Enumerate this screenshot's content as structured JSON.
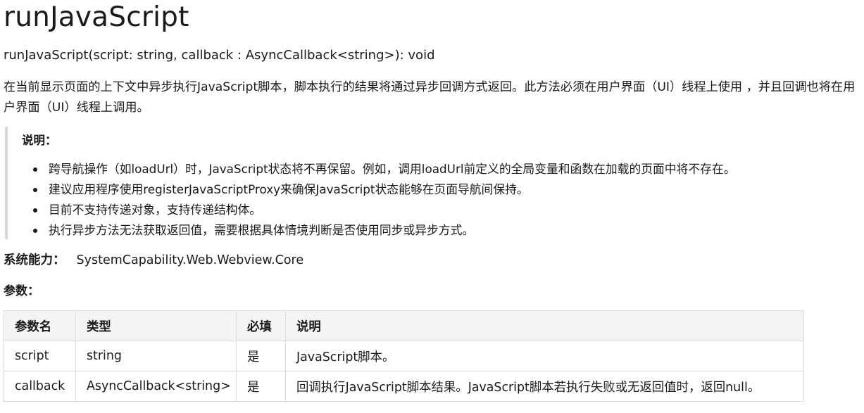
{
  "title": "runJavaScript",
  "signature": "runJavaScript(script: string, callback : AsyncCallback<string>): void",
  "description": "在当前显示页面的上下文中异步执行JavaScript脚本，脚本执行的结果将通过异步回调方式返回。此方法必须在用户界面（UI）线程上使用 ，并且回调也将在用户界面（UI）线程上调用。",
  "note": {
    "title": "说明：",
    "items": [
      "跨导航操作（如loadUrl）时，JavaScript状态将不再保留。例如，调用loadUrl前定义的全局变量和函数在加载的页面中将不存在。",
      "建议应用程序使用registerJavaScriptProxy来确保JavaScript状态能够在页面导航间保持。",
      "目前不支持传递对象，支持传递结构体。",
      "执行异步方法无法获取返回值，需要根据具体情境判断是否使用同步或异步方式。"
    ]
  },
  "syscap": {
    "label": "系统能力：",
    "value": "SystemCapability.Web.Webview.Core"
  },
  "params_label": "参数：",
  "table": {
    "headers": [
      "参数名",
      "类型",
      "必填",
      "说明"
    ],
    "rows": [
      [
        "script",
        "string",
        "是",
        "JavaScript脚本。"
      ],
      [
        "callback",
        "AsyncCallback<string>",
        "是",
        "回调执行JavaScript脚本结果。JavaScript脚本若执行失败或无返回值时，返回null。"
      ]
    ]
  }
}
